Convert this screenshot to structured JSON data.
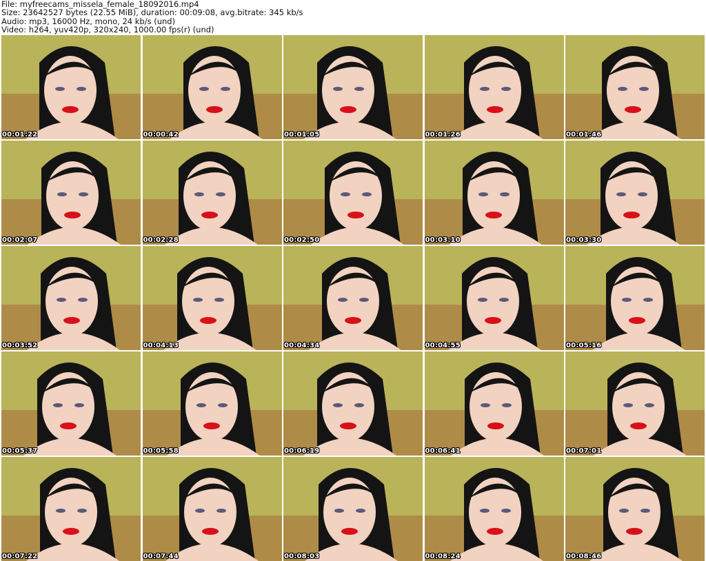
{
  "header": {
    "file_line": "File: myfreecams_missela_female_18092016.mp4",
    "size_line": "Size: 23642527 bytes (22.55 MiB), duration: 00:09:08, avg.bitrate: 345 kb/s",
    "audio_line": "Audio: mp3, 16000 Hz, mono, 24 kb/s (und)",
    "video_line": "Video: h264, yuv420p, 320x240, 1000.00 fps(r) (und)"
  },
  "colors": {
    "wall": "#b9b35a",
    "hair": "#141414",
    "skin": "#f2d2c0",
    "lips": "#d8101a",
    "background_pattern": "#a86a3a"
  },
  "thumbnails": [
    {
      "timestamp": "00:01:22"
    },
    {
      "timestamp": "00:00:42"
    },
    {
      "timestamp": "00:01:05"
    },
    {
      "timestamp": "00:01:26"
    },
    {
      "timestamp": "00:01:46"
    },
    {
      "timestamp": "00:02:07"
    },
    {
      "timestamp": "00:02:28"
    },
    {
      "timestamp": "00:02:50"
    },
    {
      "timestamp": "00:03:10"
    },
    {
      "timestamp": "00:03:30"
    },
    {
      "timestamp": "00:03:52"
    },
    {
      "timestamp": "00:04:13"
    },
    {
      "timestamp": "00:04:34"
    },
    {
      "timestamp": "00:04:55"
    },
    {
      "timestamp": "00:05:16"
    },
    {
      "timestamp": "00:05:37"
    },
    {
      "timestamp": "00:05:58"
    },
    {
      "timestamp": "00:06:19"
    },
    {
      "timestamp": "00:06:41"
    },
    {
      "timestamp": "00:07:01"
    },
    {
      "timestamp": "00:07:22"
    },
    {
      "timestamp": "00:07:44"
    },
    {
      "timestamp": "00:08:03"
    },
    {
      "timestamp": "00:08:24"
    },
    {
      "timestamp": "00:08:46"
    }
  ]
}
